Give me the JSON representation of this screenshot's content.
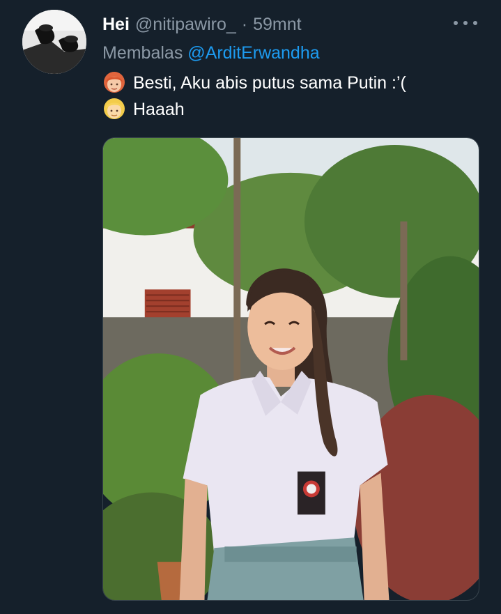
{
  "tweet": {
    "author_name": "Hei",
    "author_handle": "@nitipawiro_",
    "separator": "·",
    "timestamp": "59mnt",
    "reply_prefix": "Membalas",
    "reply_to": "@ArditErwandha",
    "lines": [
      {
        "emoji": "woman-red-hair-emoji",
        "text": "Besti, Aku abis putus sama Putin :’("
      },
      {
        "emoji": "blond-person-emoji",
        "text": "Haaah"
      }
    ],
    "photo": "photo-girl-school-uniform-garden"
  },
  "icons": {
    "more": "more-options-icon"
  },
  "colors": {
    "background": "#15202b",
    "secondary_text": "#8b98a5",
    "link": "#1d9bf0"
  }
}
